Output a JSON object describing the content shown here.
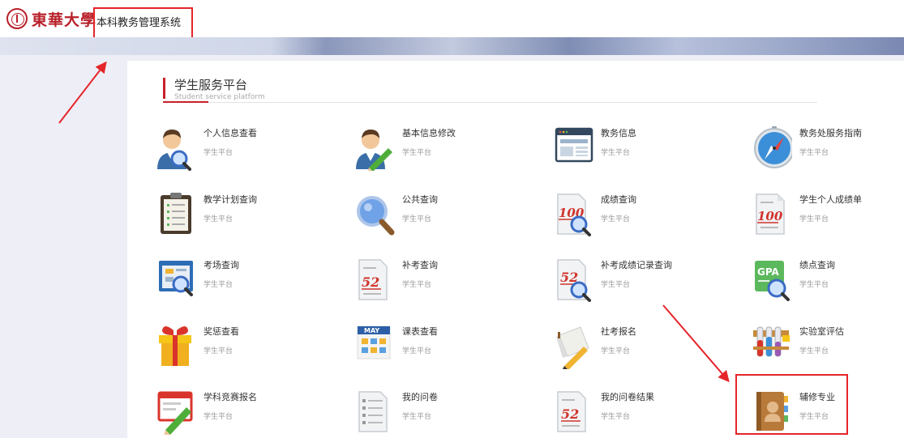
{
  "header": {
    "logo_text": "東華大學",
    "system_title": "本科教务管理系统"
  },
  "section": {
    "title": "学生服务平台",
    "subtitle": "Student service platform"
  },
  "tiles": [
    {
      "name": "个人信息查看",
      "sub": "学生平台",
      "icon": "person-search-icon"
    },
    {
      "name": "基本信息修改",
      "sub": "学生平台",
      "icon": "person-edit-icon"
    },
    {
      "name": "教务信息",
      "sub": "学生平台",
      "icon": "browser-window-icon"
    },
    {
      "name": "教务处服务指南",
      "sub": "学生平台",
      "icon": "compass-icon"
    },
    {
      "name": "教学计划查询",
      "sub": "学生平台",
      "icon": "clipboard-list-icon"
    },
    {
      "name": "公共查询",
      "sub": "学生平台",
      "icon": "magnifier-icon"
    },
    {
      "name": "成绩查询",
      "sub": "学生平台",
      "icon": "score-100-search-icon"
    },
    {
      "name": "学生个人成绩单",
      "sub": "学生平台",
      "icon": "score-100-doc-icon"
    },
    {
      "name": "考场查询",
      "sub": "学生平台",
      "icon": "screen-search-icon"
    },
    {
      "name": "补考查询",
      "sub": "学生平台",
      "icon": "score-52-doc-icon"
    },
    {
      "name": "补考成绩记录查询",
      "sub": "学生平台",
      "icon": "score-52-search-icon"
    },
    {
      "name": "绩点查询",
      "sub": "学生平台",
      "icon": "gpa-search-icon"
    },
    {
      "name": "奖惩查看",
      "sub": "学生平台",
      "icon": "gift-icon"
    },
    {
      "name": "课表查看",
      "sub": "学生平台",
      "icon": "calendar-icon",
      "badge": "MAY"
    },
    {
      "name": "社考报名",
      "sub": "学生平台",
      "icon": "paper-pencil-icon"
    },
    {
      "name": "实验室评估",
      "sub": "学生平台",
      "icon": "test-tubes-icon"
    },
    {
      "name": "学科竞赛报名",
      "sub": "学生平台",
      "icon": "window-pencil-icon"
    },
    {
      "name": "我的问卷",
      "sub": "学生平台",
      "icon": "questionnaire-icon"
    },
    {
      "name": "我的问卷结果",
      "sub": "学生平台",
      "icon": "score-52-result-icon"
    },
    {
      "name": "辅修专业",
      "sub": "学生平台",
      "icon": "address-book-icon"
    }
  ],
  "colors": {
    "brand_red": "#c8202a",
    "annotation_red": "#e5252a"
  }
}
